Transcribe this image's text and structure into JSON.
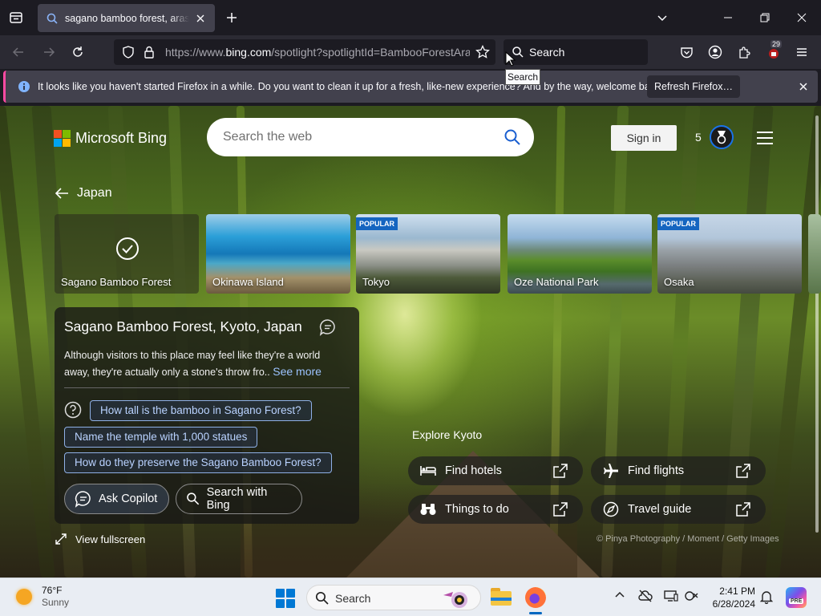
{
  "browser": {
    "tab": {
      "title": "sagano bamboo forest, arashiyama"
    },
    "url": {
      "prefix": "https://www.",
      "host": "bing.com",
      "path": "/spotlight?spotlightId=BambooForestArashiyama"
    },
    "search_label": "Search",
    "tooltip": "Search",
    "notification": {
      "text": "It looks like you haven't started Firefox in a while. Do you want to clean it up for a fresh, like-new experience? And by the way, welcome back!",
      "button": "Refresh Firefox…"
    },
    "extension_badge": "29"
  },
  "bing": {
    "logo": "Microsoft Bing",
    "search_placeholder": "Search the web",
    "sign_in": "Sign in",
    "rewards_points": "5",
    "back_label": "Japan",
    "cards": [
      {
        "label": "Sagano Bamboo Forest",
        "badge": ""
      },
      {
        "label": "Okinawa Island",
        "badge": ""
      },
      {
        "label": "Tokyo",
        "badge": "POPULAR"
      },
      {
        "label": "Oze National Park",
        "badge": ""
      },
      {
        "label": "Osaka",
        "badge": "POPULAR"
      }
    ],
    "info": {
      "title": "Sagano Bamboo Forest, Kyoto, Japan",
      "description": "Although visitors to this place may feel like they're a world away, they're actually only a stone's throw fro..",
      "see_more": "See more",
      "questions": [
        "How tall is the bamboo in Sagano Forest?",
        "Name the temple with 1,000 statues",
        "How do they preserve the Sagano Bamboo Forest?"
      ],
      "ask_copilot": "Ask Copilot",
      "search_with_bing": "Search with Bing"
    },
    "view_fullscreen": "View fullscreen",
    "explore": {
      "title": "Explore Kyoto",
      "buttons": [
        "Find hotels",
        "Find flights",
        "Things to do",
        "Travel guide"
      ]
    },
    "credit": "© Pinya Photography / Moment / Getty Images"
  },
  "taskbar": {
    "weather_temp": "76°F",
    "weather_cond": "Sunny",
    "search_label": "Search",
    "time": "2:41 PM",
    "date": "6/28/2024"
  }
}
